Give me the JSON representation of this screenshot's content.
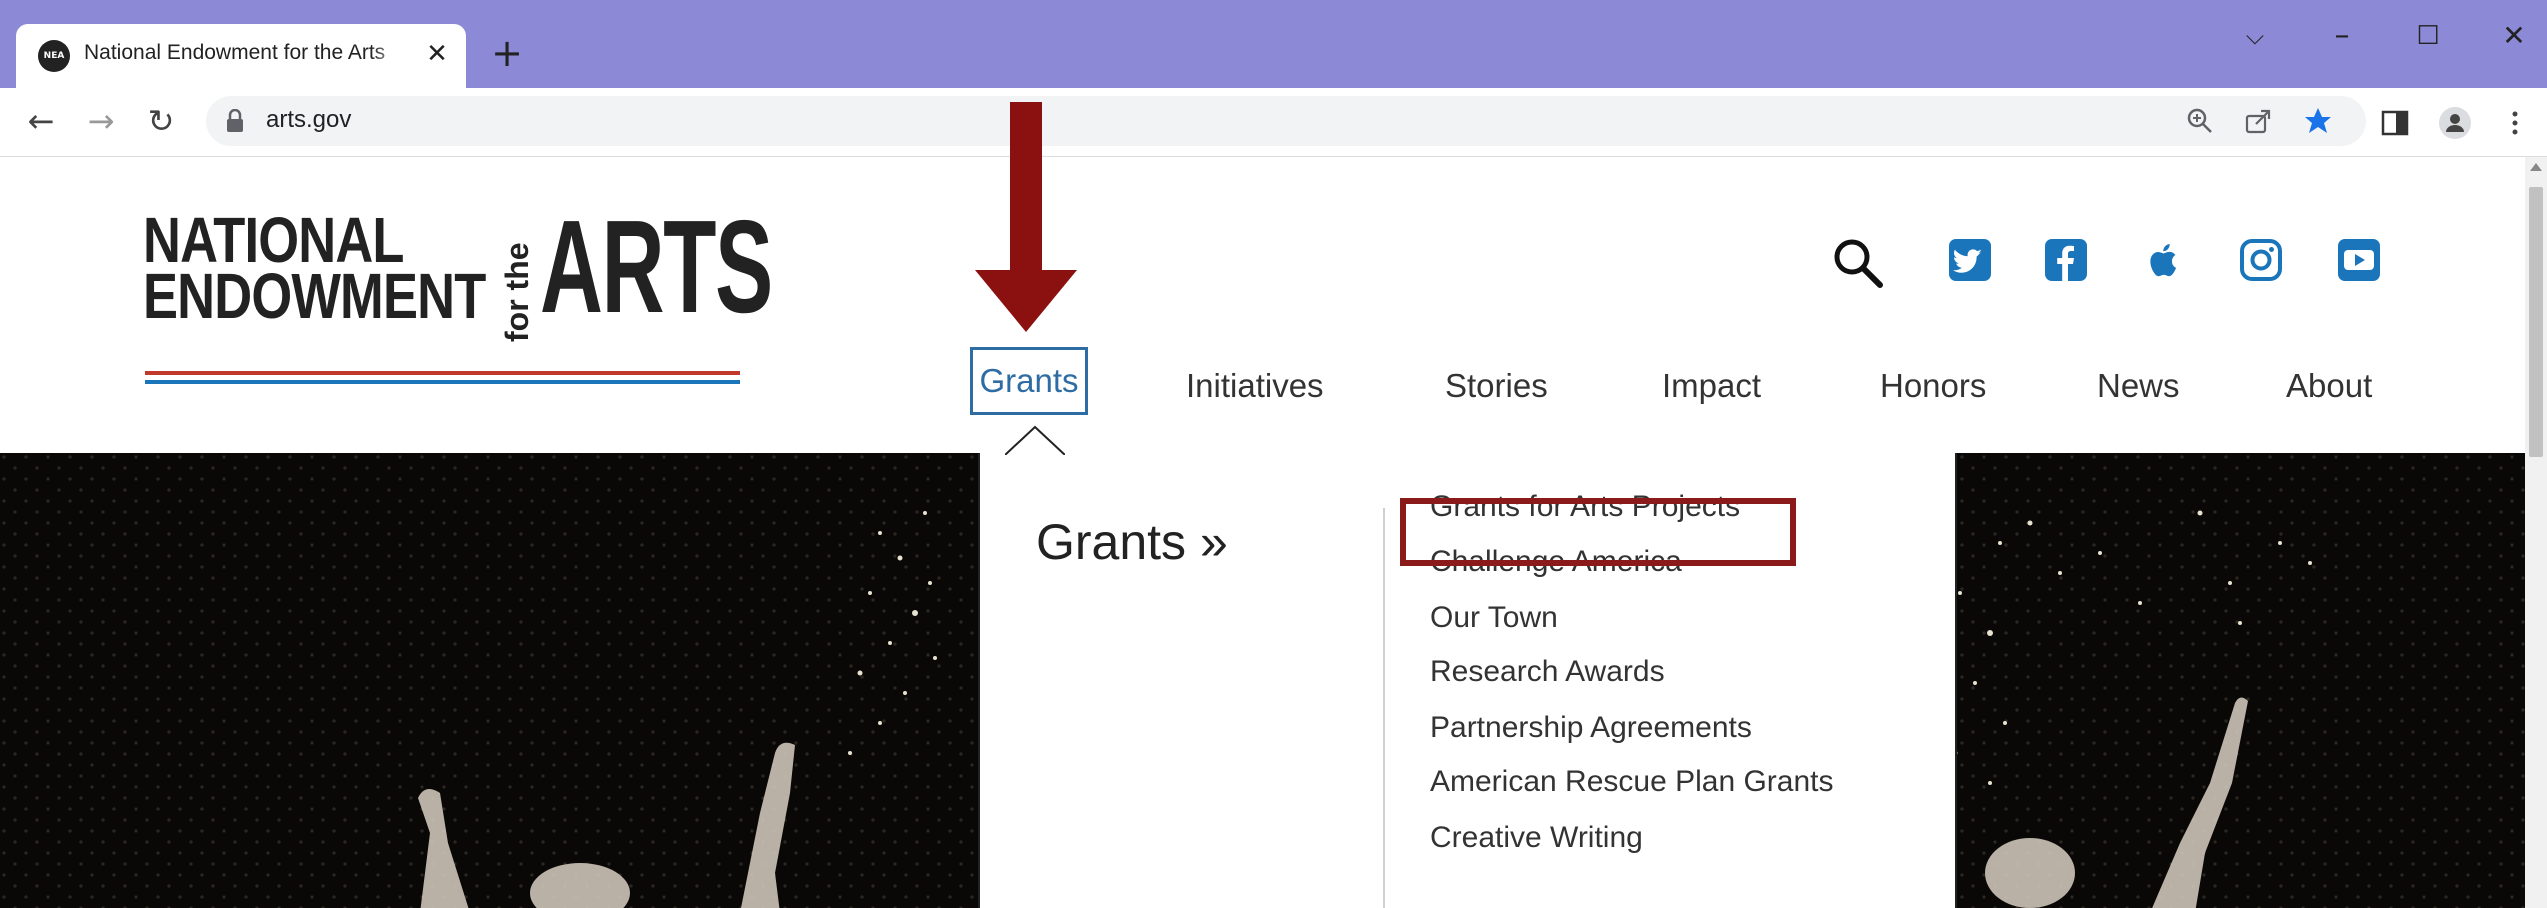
{
  "browser": {
    "tab_title": "National Endowment for the Arts",
    "tab_favicon_text": "NEA",
    "tab_close": "✕",
    "new_tab": "+",
    "window_controls": {
      "chevron": "⌵",
      "minimize": "–",
      "maximize": "☐",
      "close": "✕"
    },
    "back": "←",
    "forward": "→",
    "reload": "↻",
    "url": "arts.gov",
    "icons": [
      "zoom-icon",
      "share-icon",
      "bookmark-star-icon",
      "side-panel-icon",
      "profile-icon",
      "menu-icon"
    ],
    "colors": {
      "tabstrip": "#8c89d6",
      "star": "#1a73e8"
    }
  },
  "logo": {
    "line1": "NATIONAL",
    "line2": "ENDOWMENT",
    "for_the": "for the",
    "arts": "ARTS"
  },
  "social_icons": [
    "search-icon",
    "twitter-icon",
    "facebook-icon",
    "apple-podcasts-icon",
    "instagram-icon",
    "youtube-icon"
  ],
  "nav": {
    "items": [
      "Grants",
      "Initiatives",
      "Stories",
      "Impact",
      "Honors",
      "News",
      "About"
    ],
    "active": "Grants",
    "colors": {
      "active": "#2e6ca4",
      "social": "#1b75bb"
    }
  },
  "dropdown": {
    "heading": "Grants »",
    "links": [
      "Grants for Arts Projects",
      "Challenge America",
      "Our Town",
      "Research Awards",
      "Partnership Agreements",
      "American Rescue Plan Grants",
      "Creative Writing"
    ]
  },
  "annotations": {
    "arrow_color": "#8b1010",
    "box_color": "#8b1a1a"
  }
}
